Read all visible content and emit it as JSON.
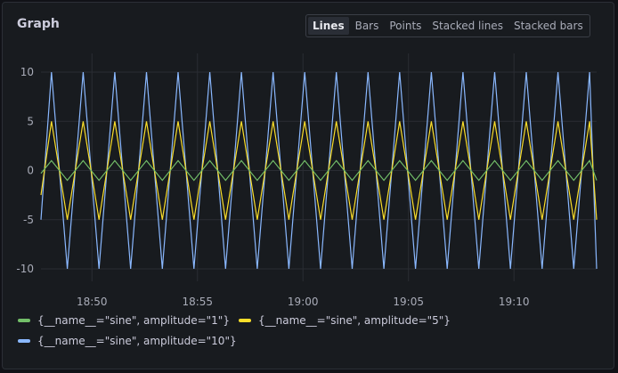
{
  "panel": {
    "title": "Graph"
  },
  "view_toggle": {
    "options": [
      "Lines",
      "Bars",
      "Points",
      "Stacked lines",
      "Stacked bars"
    ],
    "selected": "Lines"
  },
  "chart_data": {
    "type": "line",
    "title": "Graph",
    "x_ticks": [
      "18:50",
      "18:55",
      "19:00",
      "19:05",
      "19:10"
    ],
    "x_range": [
      "18:47:35",
      "19:13:55"
    ],
    "y_ticks": [
      10,
      5,
      0,
      -5,
      -10
    ],
    "ylim": [
      -10,
      10
    ],
    "grid": true,
    "legend_placement": "bottom",
    "peak_times": [
      "18:48:05",
      "18:49:35",
      "18:51:05",
      "18:52:35",
      "18:54:05",
      "18:55:35",
      "18:57:05",
      "18:58:35",
      "19:00:05",
      "19:01:35",
      "19:03:05",
      "19:04:35",
      "19:06:05",
      "19:07:35",
      "19:09:05",
      "19:10:35",
      "19:12:05",
      "19:13:35"
    ],
    "trough_times": [
      "18:48:50",
      "18:50:20",
      "18:51:50",
      "18:53:20",
      "18:54:50",
      "18:56:20",
      "18:57:50",
      "18:59:20",
      "19:00:50",
      "19:02:20",
      "19:03:50",
      "19:05:20",
      "19:06:50",
      "19:08:20",
      "19:09:50",
      "19:11:20",
      "19:12:50"
    ],
    "series": [
      {
        "name": "{__name__=\"sine\", amplitude=\"1\"}",
        "amplitude": 1,
        "color": "#73bf69",
        "start_value": -0.3,
        "end_value": -1
      },
      {
        "name": "{__name__=\"sine\", amplitude=\"5\"}",
        "amplitude": 5,
        "color": "#fade2a",
        "start_value": -2.5,
        "end_value": -5
      },
      {
        "name": "{__name__=\"sine\", amplitude=\"10\"}",
        "amplitude": 10,
        "color": "#8ab8ff",
        "start_value": -5,
        "end_value": -10
      }
    ]
  }
}
